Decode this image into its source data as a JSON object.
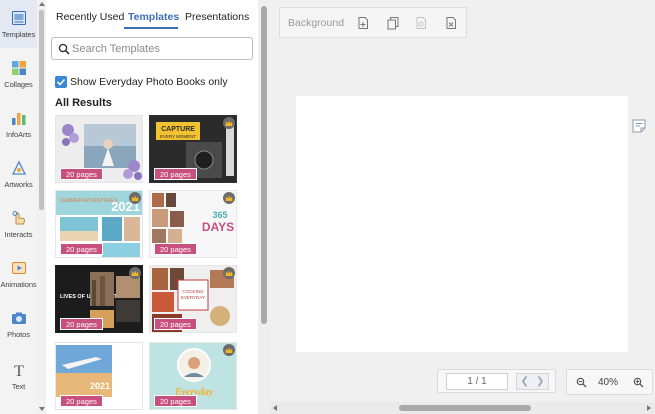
{
  "rail": {
    "items": [
      {
        "label": "Templates",
        "icon": "templates-icon",
        "active": true
      },
      {
        "label": "Collages",
        "icon": "collages-icon"
      },
      {
        "label": "InfoArts",
        "icon": "infoarts-icon"
      },
      {
        "label": "Artworks",
        "icon": "artworks-icon"
      },
      {
        "label": "Interacts",
        "icon": "interacts-icon"
      },
      {
        "label": "Animations",
        "icon": "animations-icon"
      },
      {
        "label": "Photos",
        "icon": "photos-icon"
      },
      {
        "label": "Text",
        "icon": "text-icon"
      }
    ]
  },
  "panel": {
    "tabs": [
      "Recently Used",
      "Templates",
      "Presentations"
    ],
    "active_tab": "Templates",
    "search_placeholder": "Search Templates",
    "checkbox_label": "Show Everyday Photo Books only",
    "checkbox_checked": true,
    "results_title": "All Results",
    "templates": [
      {
        "pages": "20 pages",
        "premium": false,
        "theme": "lavender-beach"
      },
      {
        "pages": "20 pages",
        "premium": true,
        "theme": "capture-every-moment",
        "text_1": "CAPTURE",
        "text_2": "EVERY MOMENT"
      },
      {
        "pages": "20 pages",
        "premium": true,
        "theme": "summer-adventures",
        "text_1": "SUMMER ADVENTURES",
        "text_2": "2021"
      },
      {
        "pages": "20 pages",
        "premium": true,
        "theme": "365-days",
        "text_1": "365",
        "text_2": "DAYS"
      },
      {
        "pages": "20 pages",
        "premium": true,
        "theme": "lives-of-urban-city",
        "text_1": "LIVES OF URBAN CITY"
      },
      {
        "pages": "20 pages",
        "premium": true,
        "theme": "cooking-everyday",
        "text_1": "COOKING",
        "text_2": "EVERYDAY"
      },
      {
        "pages": "20 pages",
        "premium": false,
        "theme": "travel-2021",
        "text_1": "2021"
      },
      {
        "pages": "20 pages",
        "premium": true,
        "theme": "everyday",
        "text_1": "Everyday"
      }
    ]
  },
  "toolbar": {
    "background_label": "Background"
  },
  "pager": {
    "page_value": "1 / 1"
  },
  "zoom": {
    "value": "40%"
  },
  "colors": {
    "accent": "#3a6fb8",
    "badge": "#c8507e",
    "crown": "#f0b429"
  }
}
